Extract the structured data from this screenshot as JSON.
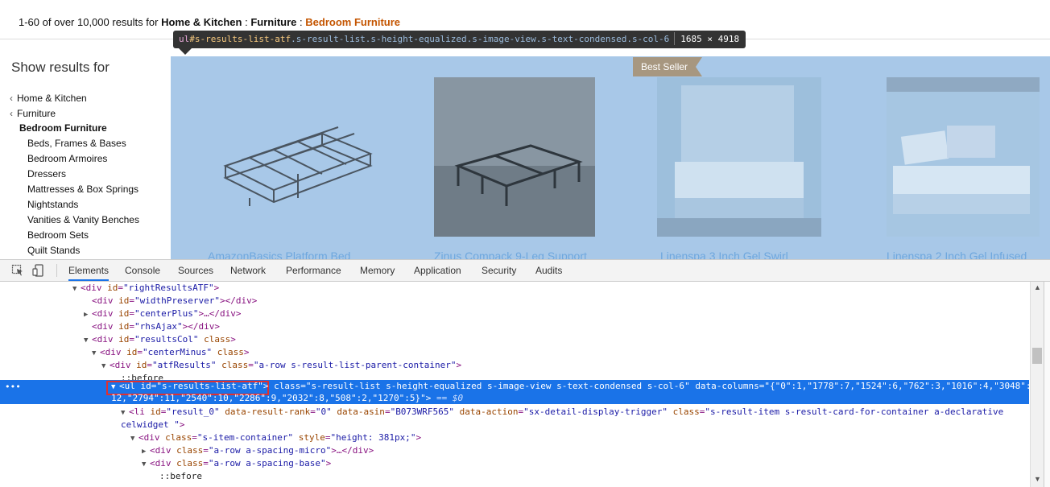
{
  "header": {
    "results_range": "1-60 of over 10,000 results for",
    "crumb1": "Home & Kitchen",
    "sep1": ":",
    "crumb2": "Furniture",
    "sep2": ":",
    "crumb3": "Bedroom Furniture"
  },
  "tooltip": {
    "tag": "ul",
    "id": "#s-results-list-atf",
    "classes": ".s-result-list.s-height-equalized.s-image-view.s-text-condensed.s-col-6",
    "size": "1685 × 4918"
  },
  "sidebar": {
    "title": "Show results for",
    "items": [
      {
        "label": "Home & Kitchen"
      },
      {
        "label": "Furniture"
      },
      {
        "label": "Bedroom Furniture"
      },
      {
        "label": "Beds, Frames & Bases"
      },
      {
        "label": "Bedroom Armoires"
      },
      {
        "label": "Dressers"
      },
      {
        "label": "Mattresses & Box Springs"
      },
      {
        "label": "Nightstands"
      },
      {
        "label": "Vanities & Vanity Benches"
      },
      {
        "label": "Bedroom Sets"
      },
      {
        "label": "Quilt Stands"
      }
    ]
  },
  "products": [
    {
      "title": "AmazonBasics Platform Bed"
    },
    {
      "title": "Zinus Compack 9-Leg Support"
    },
    {
      "title": "Linenspa 3 Inch Gel Swirl",
      "badge": "Best Seller"
    },
    {
      "title": "Linenspa 2 Inch Gel Infused"
    }
  ],
  "devtools": {
    "tabs": [
      "Elements",
      "Console",
      "Sources",
      "Network",
      "Performance",
      "Memory",
      "Application",
      "Security",
      "Audits"
    ],
    "active_tab": "Elements",
    "dom": {
      "l1_tag": "div",
      "l1_attr": "id",
      "l1_val": "rightResultsATF",
      "l2_tag": "div",
      "l2_attr": "id",
      "l2_val": "widthPreserver",
      "l2_close": "</div>",
      "l3_tag": "div",
      "l3_attr": "id",
      "l3_val": "centerPlus",
      "l3_close": "…</div>",
      "l4_tag": "div",
      "l4_attr": "id",
      "l4_val": "rhsAjax",
      "l4_close": "</div>",
      "l5_tag": "div",
      "l5_attr": "id",
      "l5_val": "resultsCol",
      "l5_attr2": "class",
      "l6_tag": "div",
      "l6_attr": "id",
      "l6_val": "centerMinus",
      "l6_attr2": "class",
      "l7_tag": "div",
      "l7_attr": "id",
      "l7_val": "atfResults",
      "l7_attr2": "class",
      "l7_val2": "a-row s-result-list-parent-container",
      "l8_pseudo": "::before",
      "sel_tag": "ul",
      "sel_attr": "id",
      "sel_val": "s-results-list-atf",
      "sel_attr2": "class",
      "sel_val2": "s-result-list s-height-equalized s-image-view s-text-condensed s-col-6",
      "sel_attr3": "data-columns",
      "sel_val3a": "{\"0\":1,\"1778\":7,\"1524\":6,\"762\":3,\"1016\":4,\"3048\":",
      "sel_val3b": "12,\"2794\":11,\"2540\":10,\"2286\":9,\"2032\":8,\"508\":2,\"1270\":5}",
      "sel_eq": "== $0",
      "l10_tag": "li",
      "l10_attr": "id",
      "l10_val": "result_0",
      "l10_attr2": "data-result-rank",
      "l10_val2": "0",
      "l10_attr3": "data-asin",
      "l10_val3": "B073WRF565",
      "l10_attr4": "data-action",
      "l10_val4": "sx-detail-display-trigger",
      "l10_attr5": "class",
      "l10_val5": "s-result-item s-result-card-for-container a-declarative",
      "l10_cont": "celwidget",
      "l11_tag": "div",
      "l11_attr": "class",
      "l11_val": "s-item-container",
      "l11_attr2": "style",
      "l11_val2": "height: 381px;",
      "l12_tag": "div",
      "l12_attr": "class",
      "l12_val": "a-row a-spacing-micro",
      "l12_close": "…</div>",
      "l13_tag": "div",
      "l13_attr": "class",
      "l13_val": "a-row a-spacing-base",
      "l14_pseudo": "::before"
    }
  }
}
